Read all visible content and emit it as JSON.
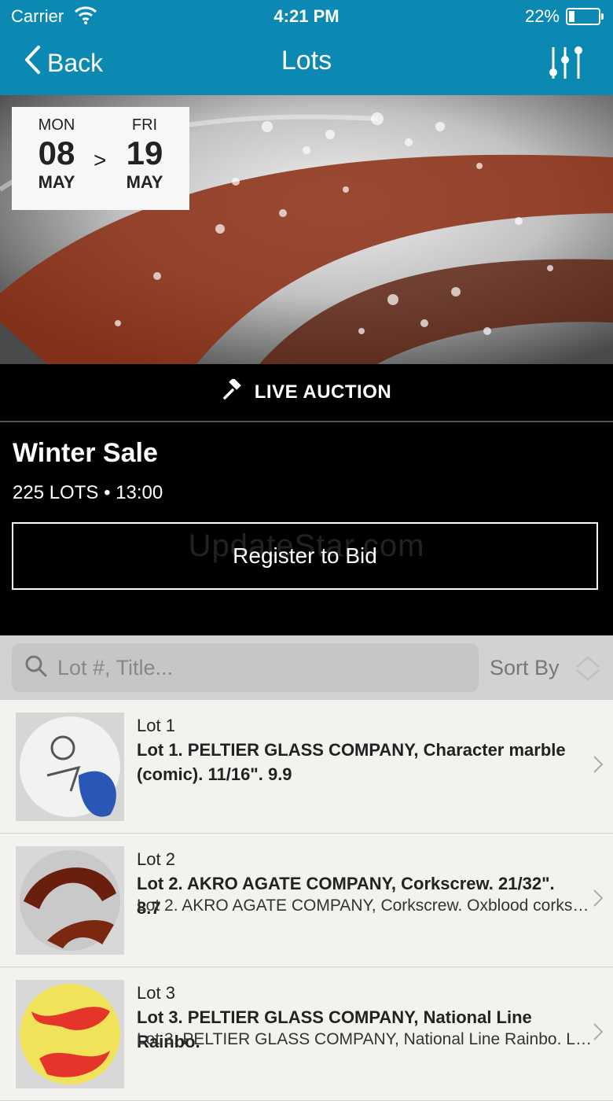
{
  "status_bar": {
    "carrier": "Carrier",
    "time": "4:21 PM",
    "battery_pct": "22%",
    "battery_level": 0.22
  },
  "nav": {
    "back_label": "Back",
    "title": "Lots"
  },
  "auction": {
    "start": {
      "dow": "MON",
      "day": "08",
      "month": "MAY"
    },
    "end": {
      "dow": "FRI",
      "day": "19",
      "month": "MAY"
    },
    "arrow": ">",
    "live_label": "LIVE AUCTION",
    "sale_title": "Winter Sale",
    "sale_meta": "225 LOTS • 13:00",
    "register_label": "Register to Bid",
    "watermark": "UpdateStar.com"
  },
  "search": {
    "placeholder": "Lot #, Title...",
    "sort_label": "Sort By"
  },
  "lots": [
    {
      "number": "Lot 1",
      "title": "Lot 1. PELTIER GLASS COMPANY, Character marble (comic). 11/16\". 9.9",
      "description": ""
    },
    {
      "number": "Lot 2",
      "title": "Lot 2. AKRO AGATE COMPANY, Corkscrew. 21/32\". 8.7",
      "description": "Lot 2. AKRO AGATE COMPANY, Corkscrew. Oxblood corkscrew..."
    },
    {
      "number": "Lot 3",
      "title": "Lot 3. PELTIER GLASS COMPANY, National Line Rainbo.",
      "description": "Lot 3. PELTIER GLASS COMPANY, National Line Rainbo. Lot of..."
    }
  ],
  "colors": {
    "accent": "#0c89b3",
    "dark": "#000000",
    "list_bg": "#f3f2ef"
  },
  "icons": [
    "wifi-icon",
    "battery-icon",
    "back-chevron-icon",
    "filter-sliders-icon",
    "gavel-icon",
    "search-icon",
    "sort-icon",
    "chevron-right-icon"
  ]
}
